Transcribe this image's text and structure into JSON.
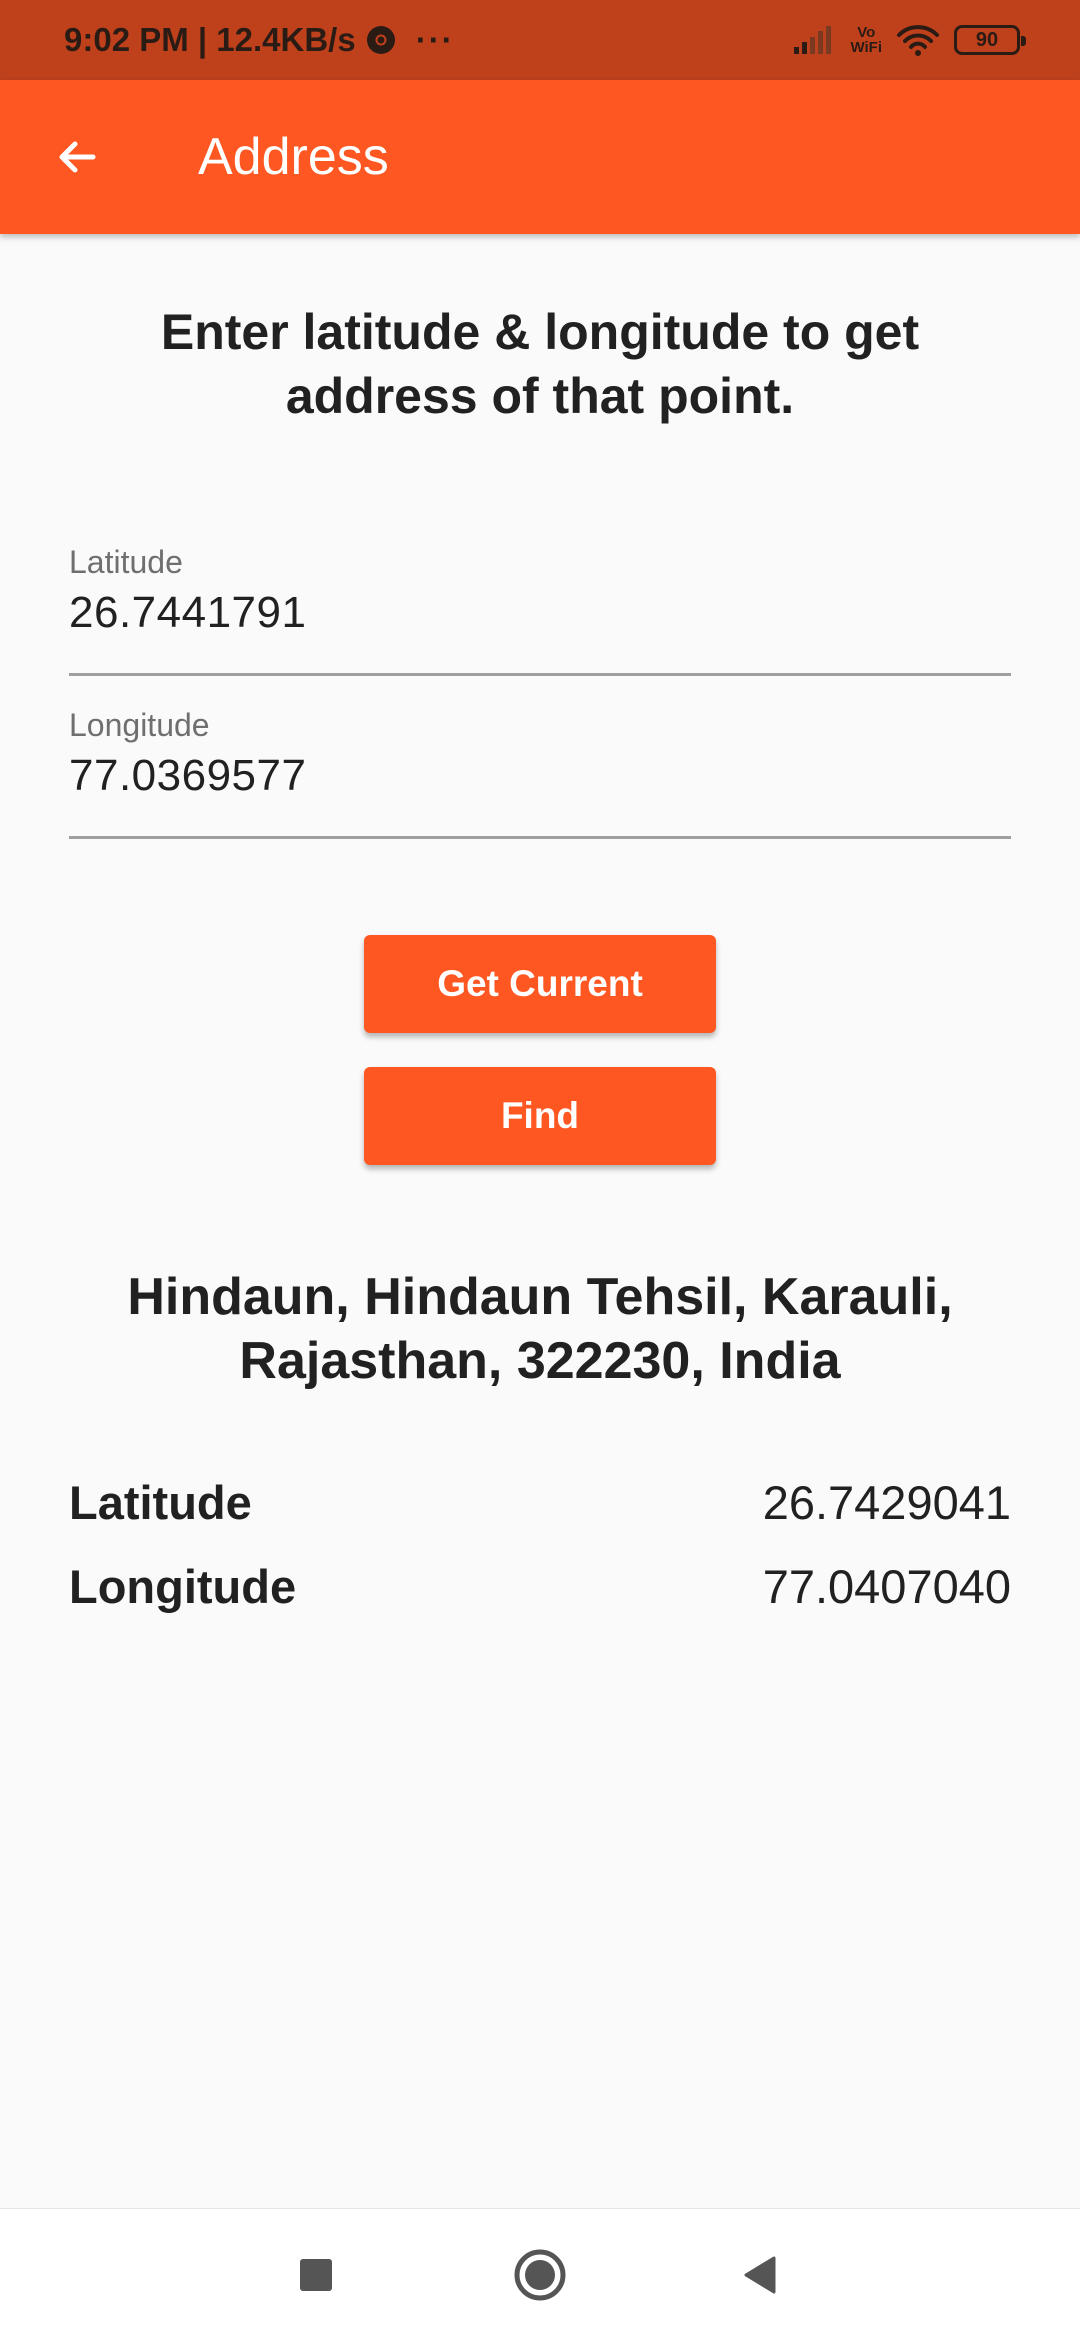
{
  "status_bar": {
    "time_speed": "9:02 PM | 12.4KB/s",
    "more": "···",
    "vowifi_top": "Vo",
    "vowifi_bottom": "WiFi",
    "battery": "90"
  },
  "app_bar": {
    "back_icon": "arrow-left-icon",
    "title": "Address"
  },
  "instruction": "Enter latitude & longitude to get address of that point.",
  "form": {
    "latitude": {
      "label": "Latitude",
      "value": "26.7441791"
    },
    "longitude": {
      "label": "Longitude",
      "value": "77.0369577"
    }
  },
  "buttons": {
    "get_current": "Get Current",
    "find": "Find"
  },
  "result": {
    "address": "Hindaun, Hindaun Tehsil, Karauli, Rajasthan, 322230, India",
    "latitude_label": "Latitude",
    "latitude_value": "26.7429041",
    "longitude_label": "Longitude",
    "longitude_value": "77.0407040"
  },
  "nav_bar": {
    "recents_icon": "square-icon",
    "home_icon": "circle-icon",
    "back_icon": "triangle-back-icon"
  },
  "colors": {
    "status_bar": "#bf411c",
    "primary": "#ff5722",
    "background": "#fafafa",
    "text": "#212121"
  }
}
